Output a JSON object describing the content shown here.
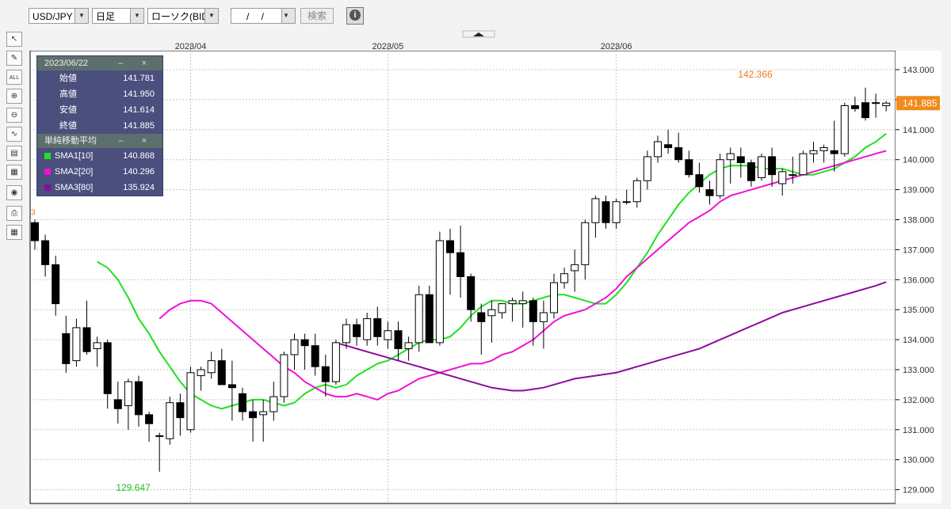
{
  "toolbar": {
    "pair": "USD/JPY",
    "timeframe": "日足",
    "chart_type": "ローソク(BID)",
    "date_value": "/ /",
    "search_label": "検索",
    "info_label": "i"
  },
  "tools": [
    "pointer-tool",
    "pencil-tool",
    "eraser-all-tool",
    "zoom-in-tool",
    "zoom-out-tool",
    "indicator-tool",
    "compare-tool",
    "candle-style-tool",
    "eye-tool",
    "print-tool",
    "grid-tool"
  ],
  "tool_glyphs": {
    "pointer-tool": "↖",
    "pencil-tool": "✎",
    "eraser-all-tool": "ALL",
    "zoom-in-tool": "⊕",
    "zoom-out-tool": "⊖",
    "indicator-tool": "∿",
    "compare-tool": "▤",
    "candle-style-tool": "▦",
    "eye-tool": "◉",
    "print-tool": "⎙",
    "grid-tool": "▦"
  },
  "ohlc_panel": {
    "date": "2023/06/22",
    "controls": "– ×",
    "rows": [
      {
        "label": "始値",
        "value": "141.781"
      },
      {
        "label": "高値",
        "value": "141.950"
      },
      {
        "label": "安値",
        "value": "141.614"
      },
      {
        "label": "終値",
        "value": "141.885"
      }
    ]
  },
  "sma_panel": {
    "title": "単純移動平均",
    "controls": "– ×",
    "rows": [
      {
        "label": "SMA1[10]",
        "value": "140.868",
        "color": "#22e022"
      },
      {
        "label": "SMA2[20]",
        "value": "140.296",
        "color": "#f010d8"
      },
      {
        "label": "SMA3[80]",
        "value": "135.924",
        "color": "#8b0d9b"
      }
    ]
  },
  "chart_data": {
    "type": "candlestick",
    "x_labels": [
      {
        "label": "2023/04",
        "index": 15
      },
      {
        "label": "2023/05",
        "index": 34
      },
      {
        "label": "2023/06",
        "index": 56
      }
    ],
    "y_ticks": [
      "129.000",
      "130.000",
      "131.000",
      "132.000",
      "133.000",
      "134.000",
      "135.000",
      "136.000",
      "137.000",
      "138.000",
      "139.000",
      "140.000",
      "141.000",
      "142.000",
      "143.000"
    ],
    "ylim": [
      128.6,
      143.55
    ],
    "current_price": "141.885",
    "current_price_color": "#f08a1c",
    "high_annotation": {
      "text": "142.366",
      "index": 70,
      "value": 142.366,
      "color": "#f07820"
    },
    "low_annotation": {
      "text": "129.647",
      "index": 11,
      "value": 129.647,
      "color": "#22c022"
    },
    "left_edge_annotation": {
      "text": "3",
      "value": 138.1,
      "color": "#f07820"
    },
    "grid": true,
    "up_color": "#ffffff",
    "down_color": "#000000",
    "candles": [
      [
        137.9,
        138.0,
        137.0,
        137.3
      ],
      [
        137.3,
        137.5,
        136.1,
        136.5
      ],
      [
        136.5,
        136.8,
        134.8,
        135.2
      ],
      [
        134.2,
        134.8,
        132.9,
        133.2
      ],
      [
        133.3,
        134.7,
        133.1,
        134.4
      ],
      [
        134.4,
        135.3,
        133.5,
        133.6
      ],
      [
        133.7,
        134.1,
        133.1,
        133.9
      ],
      [
        133.9,
        134.0,
        131.7,
        132.2
      ],
      [
        132.0,
        132.6,
        131.2,
        131.7
      ],
      [
        131.8,
        132.7,
        131.0,
        132.6
      ],
      [
        132.6,
        132.8,
        131.1,
        131.5
      ],
      [
        131.5,
        131.6,
        130.6,
        131.2
      ],
      [
        130.8,
        130.9,
        129.6,
        130.8
      ],
      [
        130.7,
        132.1,
        130.5,
        131.9
      ],
      [
        131.9,
        132.2,
        130.8,
        131.4
      ],
      [
        131.0,
        133.1,
        130.9,
        132.9
      ],
      [
        132.8,
        133.1,
        132.3,
        133.0
      ],
      [
        132.9,
        133.6,
        132.7,
        133.3
      ],
      [
        133.3,
        133.7,
        132.7,
        132.5
      ],
      [
        132.5,
        133.3,
        131.3,
        132.4
      ],
      [
        132.2,
        132.4,
        131.3,
        131.6
      ],
      [
        131.6,
        132.0,
        130.6,
        131.4
      ],
      [
        131.5,
        132.0,
        130.6,
        131.6
      ],
      [
        131.6,
        132.6,
        131.3,
        132.1
      ],
      [
        132.1,
        133.6,
        131.9,
        133.5
      ],
      [
        133.5,
        134.2,
        133.0,
        134.0
      ],
      [
        134.0,
        134.2,
        133.0,
        133.8
      ],
      [
        133.8,
        134.2,
        132.8,
        133.1
      ],
      [
        133.1,
        133.5,
        132.1,
        132.6
      ],
      [
        132.6,
        134.0,
        132.5,
        133.9
      ],
      [
        133.9,
        134.7,
        133.7,
        134.5
      ],
      [
        134.5,
        134.7,
        133.8,
        134.1
      ],
      [
        134.0,
        134.9,
        133.8,
        134.7
      ],
      [
        134.7,
        135.1,
        133.8,
        134.1
      ],
      [
        134.0,
        134.6,
        133.7,
        134.3
      ],
      [
        134.3,
        134.6,
        133.3,
        133.7
      ],
      [
        133.7,
        134.1,
        133.3,
        133.9
      ],
      [
        133.9,
        135.8,
        133.6,
        135.5
      ],
      [
        135.5,
        135.8,
        133.9,
        133.9
      ],
      [
        133.9,
        137.6,
        133.8,
        137.3
      ],
      [
        137.3,
        137.7,
        135.5,
        136.9
      ],
      [
        136.9,
        137.8,
        135.4,
        136.1
      ],
      [
        136.1,
        136.2,
        134.6,
        135.0
      ],
      [
        134.9,
        135.2,
        133.5,
        134.6
      ],
      [
        134.8,
        135.3,
        133.9,
        135.0
      ],
      [
        134.9,
        135.2,
        134.7,
        135.2
      ],
      [
        135.2,
        135.4,
        134.6,
        135.3
      ],
      [
        135.2,
        135.6,
        134.4,
        135.3
      ],
      [
        135.3,
        135.4,
        133.8,
        134.6
      ],
      [
        134.6,
        135.3,
        133.7,
        134.9
      ],
      [
        134.9,
        136.2,
        134.7,
        135.9
      ],
      [
        135.9,
        136.4,
        135.7,
        136.2
      ],
      [
        136.3,
        137.0,
        135.6,
        136.5
      ],
      [
        136.5,
        138.0,
        136.0,
        137.9
      ],
      [
        137.9,
        138.8,
        137.4,
        138.7
      ],
      [
        138.6,
        138.8,
        137.7,
        137.9
      ],
      [
        137.9,
        138.7,
        137.7,
        138.6
      ],
      [
        138.6,
        139.0,
        138.5,
        138.6
      ],
      [
        138.6,
        139.4,
        138.4,
        139.3
      ],
      [
        139.3,
        140.3,
        139.0,
        140.1
      ],
      [
        140.1,
        140.8,
        139.9,
        140.6
      ],
      [
        140.5,
        141.0,
        140.2,
        140.4
      ],
      [
        140.4,
        140.9,
        139.9,
        140.0
      ],
      [
        140.0,
        140.3,
        139.4,
        139.5
      ],
      [
        139.5,
        139.9,
        138.9,
        139.1
      ],
      [
        139.0,
        139.3,
        138.5,
        138.8
      ],
      [
        138.8,
        140.2,
        138.7,
        140.0
      ],
      [
        140.0,
        140.4,
        139.2,
        140.2
      ],
      [
        140.1,
        140.4,
        139.4,
        139.9
      ],
      [
        139.9,
        140.0,
        139.1,
        139.3
      ],
      [
        139.4,
        140.2,
        139.3,
        140.1
      ],
      [
        140.1,
        140.4,
        139.1,
        139.5
      ],
      [
        139.2,
        139.7,
        138.8,
        139.6
      ],
      [
        139.5,
        140.1,
        139.2,
        139.5
      ],
      [
        139.5,
        140.3,
        139.5,
        140.2
      ],
      [
        140.2,
        140.6,
        139.9,
        140.3
      ],
      [
        140.3,
        140.5,
        139.9,
        140.4
      ],
      [
        140.3,
        141.3,
        139.6,
        140.2
      ],
      [
        140.2,
        141.9,
        140.1,
        141.8
      ],
      [
        141.8,
        142.1,
        141.6,
        141.7
      ],
      [
        141.9,
        142.4,
        141.3,
        141.4
      ],
      [
        141.9,
        142.2,
        141.4,
        141.9
      ],
      [
        141.8,
        141.95,
        141.61,
        141.885
      ]
    ],
    "series": [
      {
        "name": "SMA1[10]",
        "color": "#22e022",
        "values": [
          136.6,
          136.4,
          136.0,
          135.4,
          134.7,
          134.2,
          133.6,
          133.1,
          132.6,
          132.2,
          132.0,
          131.8,
          131.7,
          131.8,
          131.9,
          132.0,
          132.0,
          131.9,
          131.8,
          131.9,
          132.2,
          132.4,
          132.5,
          132.4,
          132.5,
          132.8,
          133.0,
          133.2,
          133.3,
          133.5,
          133.7,
          133.9,
          134.0,
          134.0,
          134.1,
          134.4,
          134.8,
          135.1,
          135.3,
          135.3,
          135.2,
          135.2,
          135.3,
          135.4,
          135.5,
          135.5,
          135.4,
          135.3,
          135.2,
          135.2,
          135.5,
          135.9,
          136.4,
          136.9,
          137.5,
          138.0,
          138.5,
          138.9,
          139.2,
          139.5,
          139.7,
          139.8,
          139.8,
          139.8,
          139.7,
          139.7,
          139.7,
          139.6,
          139.5,
          139.5,
          139.6,
          139.7,
          139.9,
          140.1,
          140.4,
          140.6,
          140.868
        ]
      },
      {
        "name": "SMA2[20]",
        "color": "#f010d8",
        "values": [
          134.7,
          135.0,
          135.2,
          135.3,
          135.3,
          135.2,
          134.9,
          134.6,
          134.3,
          134.0,
          133.7,
          133.4,
          133.1,
          132.9,
          132.6,
          132.4,
          132.2,
          132.1,
          132.1,
          132.2,
          132.1,
          132.0,
          132.2,
          132.3,
          132.5,
          132.7,
          132.8,
          132.9,
          133.0,
          133.1,
          133.2,
          133.2,
          133.3,
          133.5,
          133.6,
          133.8,
          134.0,
          134.3,
          134.6,
          134.8,
          134.9,
          135.0,
          135.2,
          135.4,
          135.7,
          136.1,
          136.4,
          136.7,
          137.0,
          137.3,
          137.6,
          137.9,
          138.1,
          138.3,
          138.6,
          138.8,
          138.9,
          139.0,
          139.1,
          139.2,
          139.3,
          139.4,
          139.5,
          139.6,
          139.7,
          139.8,
          139.9,
          140.0,
          140.1,
          140.2,
          140.296
        ]
      },
      {
        "name": "SMA3[80]",
        "color": "#8b0d9b",
        "values": [
          133.9,
          133.8,
          133.7,
          133.6,
          133.5,
          133.4,
          133.3,
          133.2,
          133.1,
          133.0,
          132.9,
          132.8,
          132.7,
          132.6,
          132.5,
          132.4,
          132.35,
          132.3,
          132.3,
          132.35,
          132.4,
          132.5,
          132.6,
          132.7,
          132.75,
          132.8,
          132.85,
          132.9,
          133.0,
          133.1,
          133.2,
          133.3,
          133.4,
          133.5,
          133.6,
          133.7,
          133.85,
          134.0,
          134.15,
          134.3,
          134.45,
          134.6,
          134.75,
          134.9,
          135.0,
          135.1,
          135.2,
          135.3,
          135.4,
          135.5,
          135.6,
          135.7,
          135.8,
          135.924
        ]
      }
    ]
  }
}
